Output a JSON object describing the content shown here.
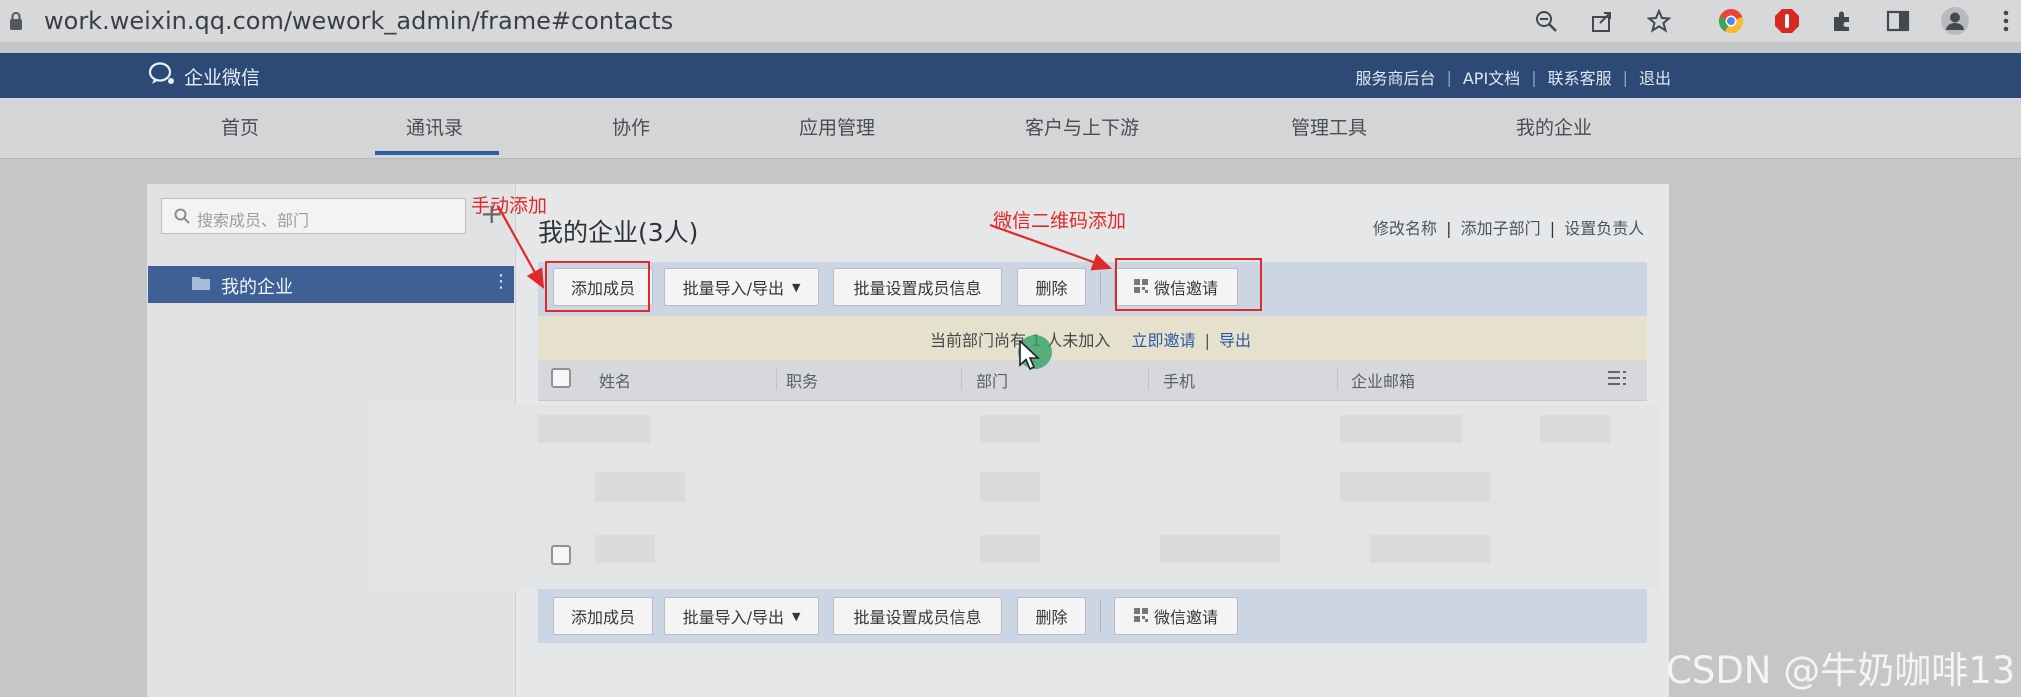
{
  "browser": {
    "url": "work.weixin.qq.com/wework_admin/frame#contacts",
    "icons": [
      "zoom-icon",
      "share-icon",
      "star-icon",
      "chrome-icon",
      "adblock-icon",
      "extensions-icon",
      "sidepanel-icon",
      "profile-icon",
      "menu-icon"
    ]
  },
  "app": {
    "logo_text": "企业微信",
    "top_links": [
      "服务商后台",
      "API文档",
      "联系客服",
      "退出"
    ]
  },
  "nav": {
    "items": [
      "首页",
      "通讯录",
      "协作",
      "应用管理",
      "客户与上下游",
      "管理工具",
      "我的企业"
    ],
    "active": "通讯录"
  },
  "sidebar": {
    "search_placeholder": "搜索成员、部门",
    "plus": "+",
    "tree_item": "我的企业",
    "kebab": "⋮"
  },
  "main": {
    "title": "我的企业(3人)",
    "header_links": [
      "修改名称",
      "添加子部门",
      "设置负责人"
    ],
    "toolbar": {
      "add_member": "添加成员",
      "import_export": "批量导入/导出",
      "batch_set": "批量设置成员信息",
      "delete": "删除",
      "wechat_invite": "微信邀请"
    },
    "notice": {
      "prefix": "当前部门尚有 1 人未加入",
      "invite_link": "立即邀请",
      "export_link": "导出"
    },
    "columns": [
      "姓名",
      "职务",
      "部门",
      "手机",
      "企业邮箱"
    ]
  },
  "annotations": {
    "manual_add": "手动添加",
    "qr_add": "微信二维码添加"
  },
  "watermark": "CSDN @牛奶咖啡13",
  "colors": {
    "topbar": "#2c4a75",
    "accent": "#2c5fa3",
    "annotation": "#e02a2a"
  }
}
